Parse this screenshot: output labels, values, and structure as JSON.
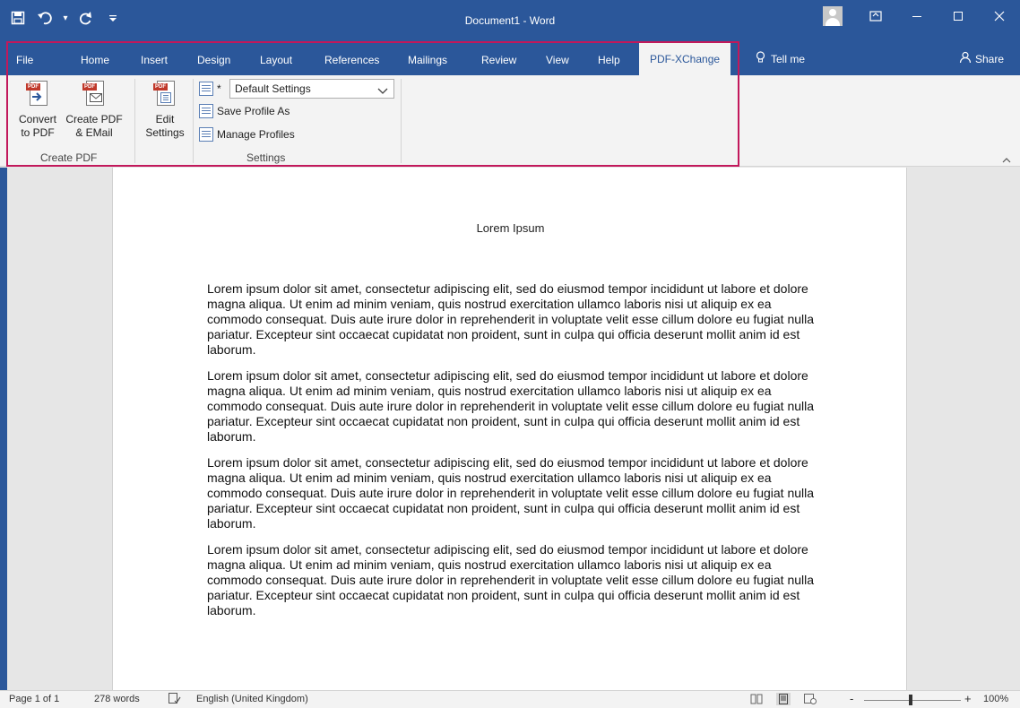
{
  "window": {
    "title": "Document1 - Word"
  },
  "tabs": [
    {
      "label": "File"
    },
    {
      "label": "Home"
    },
    {
      "label": "Insert"
    },
    {
      "label": "Design"
    },
    {
      "label": "Layout"
    },
    {
      "label": "References"
    },
    {
      "label": "Mailings"
    },
    {
      "label": "Review"
    },
    {
      "label": "View"
    },
    {
      "label": "Help"
    },
    {
      "label": "PDF-XChange"
    }
  ],
  "tell_me": "Tell me",
  "share": "Share",
  "ribbon": {
    "convert_to_pdf": {
      "line1": "Convert",
      "line2": "to PDF"
    },
    "create_pdf_email": {
      "line1": "Create PDF",
      "line2": "& EMail"
    },
    "edit_settings": {
      "line1": "Edit",
      "line2": "Settings"
    },
    "profile_select": {
      "value": "Default Settings",
      "marker": "*"
    },
    "save_profile_as": "Save Profile As",
    "manage_profiles": "Manage Profiles",
    "groups": {
      "create_pdf": "Create PDF",
      "settings": "Settings"
    }
  },
  "document": {
    "heading": "Lorem Ipsum",
    "paragraphs": [
      "Lorem ipsum dolor sit amet, consectetur adipiscing elit, sed do eiusmod tempor incididunt ut labore et dolore magna aliqua. Ut enim ad minim veniam, quis nostrud exercitation ullamco laboris nisi ut aliquip ex ea commodo consequat. Duis aute irure dolor in reprehenderit in voluptate velit esse cillum dolore eu fugiat nulla pariatur. Excepteur sint occaecat cupidatat non proident, sunt in culpa qui officia deserunt mollit anim id est laborum.",
      "Lorem ipsum dolor sit amet, consectetur adipiscing elit, sed do eiusmod tempor incididunt ut labore et dolore magna aliqua. Ut enim ad minim veniam, quis nostrud exercitation ullamco laboris nisi ut aliquip ex ea commodo consequat. Duis aute irure dolor in reprehenderit in voluptate velit esse cillum dolore eu fugiat nulla pariatur. Excepteur sint occaecat cupidatat non proident, sunt in culpa qui officia deserunt mollit anim id est laborum.",
      "Lorem ipsum dolor sit amet, consectetur adipiscing elit, sed do eiusmod tempor incididunt ut labore et dolore magna aliqua. Ut enim ad minim veniam, quis nostrud exercitation ullamco laboris nisi ut aliquip ex ea commodo consequat. Duis aute irure dolor in reprehenderit in voluptate velit esse cillum dolore eu fugiat nulla pariatur. Excepteur sint occaecat cupidatat non proident, sunt in culpa qui officia deserunt mollit anim id est laborum.",
      "Lorem ipsum dolor sit amet, consectetur adipiscing elit, sed do eiusmod tempor incididunt ut labore et dolore magna aliqua. Ut enim ad minim veniam, quis nostrud exercitation ullamco laboris nisi ut aliquip ex ea commodo consequat. Duis aute irure dolor in reprehenderit in voluptate velit esse cillum dolore eu fugiat nulla pariatur. Excepteur sint occaecat cupidatat non proident, sunt in culpa qui officia deserunt mollit anim id est laborum."
    ]
  },
  "status_bar": {
    "page": "Page 1 of 1",
    "words": "278 words",
    "language": "English (United Kingdom)",
    "zoom": "100%",
    "zoom_minus": "-",
    "zoom_plus": "+"
  },
  "colors": {
    "word_blue": "#2b579a",
    "highlight": "#c2185b",
    "pdf_red": "#c0392b"
  },
  "icons": {
    "save": "save-icon",
    "undo": "undo-icon",
    "redo": "redo-icon",
    "customize": "customize-qat-icon",
    "ribbon_display": "ribbon-display-options-icon",
    "minimize": "minimize-icon",
    "maximize": "maximize-icon",
    "close": "close-icon",
    "tell_me": "lightbulb-icon",
    "share": "person-icon"
  }
}
